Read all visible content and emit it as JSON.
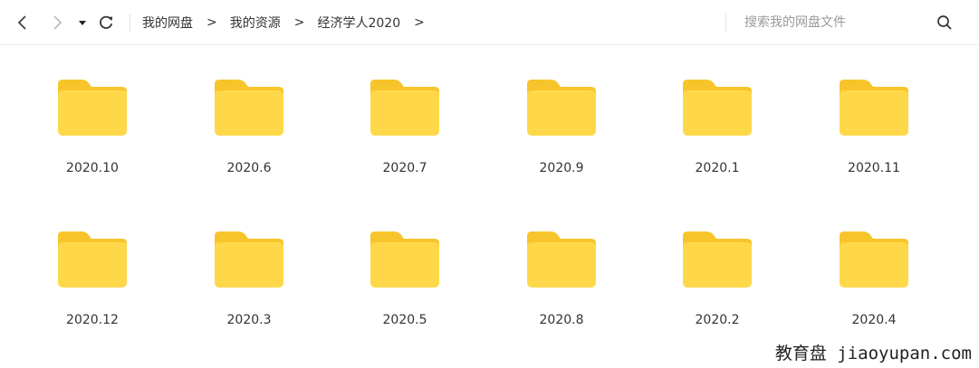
{
  "navigation": {
    "back_icon": "chevron-left-icon",
    "forward_icon": "chevron-right-icon",
    "history_icon": "caret-down-icon",
    "refresh_icon": "refresh-icon"
  },
  "breadcrumb": {
    "items": [
      {
        "label": "我的网盘"
      },
      {
        "label": "我的资源"
      },
      {
        "label": "经济学人2020"
      }
    ],
    "separator": ">"
  },
  "search": {
    "placeholder": "搜索我的网盘文件",
    "value": "",
    "icon": "search-icon"
  },
  "folders": [
    {
      "name": "2020.10"
    },
    {
      "name": "2020.6"
    },
    {
      "name": "2020.7"
    },
    {
      "name": "2020.9"
    },
    {
      "name": "2020.1"
    },
    {
      "name": "2020.11"
    },
    {
      "name": "2020.12"
    },
    {
      "name": "2020.3"
    },
    {
      "name": "2020.5"
    },
    {
      "name": "2020.8"
    },
    {
      "name": "2020.2"
    },
    {
      "name": "2020.4"
    }
  ],
  "colors": {
    "folder_body": "#ffd84a",
    "folder_tab": "#f7c52b",
    "text": "#333333",
    "placeholder": "#9a9a9a"
  },
  "watermark": {
    "text": "教育盘 jiaoyupan.com"
  }
}
